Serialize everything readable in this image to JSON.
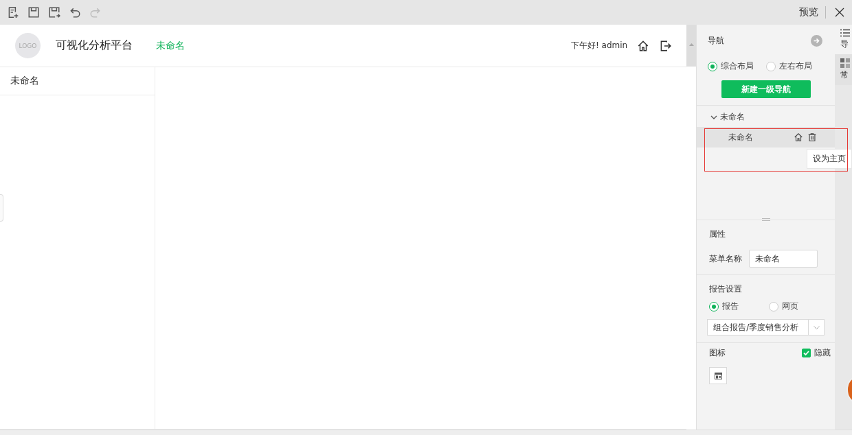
{
  "toolbar": {
    "tools": [
      {
        "kind": "new",
        "disabled": false
      },
      {
        "kind": "save",
        "disabled": false
      },
      {
        "kind": "save-as",
        "disabled": false
      },
      {
        "kind": "undo",
        "disabled": false
      },
      {
        "kind": "redo",
        "disabled": true
      }
    ],
    "preview": "预览"
  },
  "header": {
    "logo": "LOGO",
    "title": "可视化分析平台",
    "active_menu": "未命名",
    "greeting": "下午好! admin"
  },
  "sidebar": {
    "items": [
      {
        "label": "未命名",
        "selected": false
      }
    ]
  },
  "nav_panel": {
    "title": "导航",
    "layouts": [
      {
        "label": "综合布局",
        "selected": true
      },
      {
        "label": "左右布局",
        "selected": false
      }
    ],
    "new_button": "新建一级导航",
    "tree": [
      {
        "label": "未命名",
        "expanded": true,
        "children": [
          {
            "label": "未命名",
            "selected": true
          }
        ]
      }
    ],
    "tooltip": "设为主页"
  },
  "properties": {
    "title": "属性",
    "name_label": "菜单名称",
    "name_value": "未命名",
    "report_title": "报告设置",
    "report_types": [
      {
        "label": "报告",
        "selected": true
      },
      {
        "label": "网页",
        "selected": false
      }
    ],
    "report_select": "组合报告/季度销售分析",
    "icon_label": "图标",
    "hide": {
      "label": "隐藏",
      "checked": true
    }
  },
  "side_tabs": [
    {
      "label": "导",
      "selected": true
    },
    {
      "label": "常",
      "selected": false
    }
  ]
}
